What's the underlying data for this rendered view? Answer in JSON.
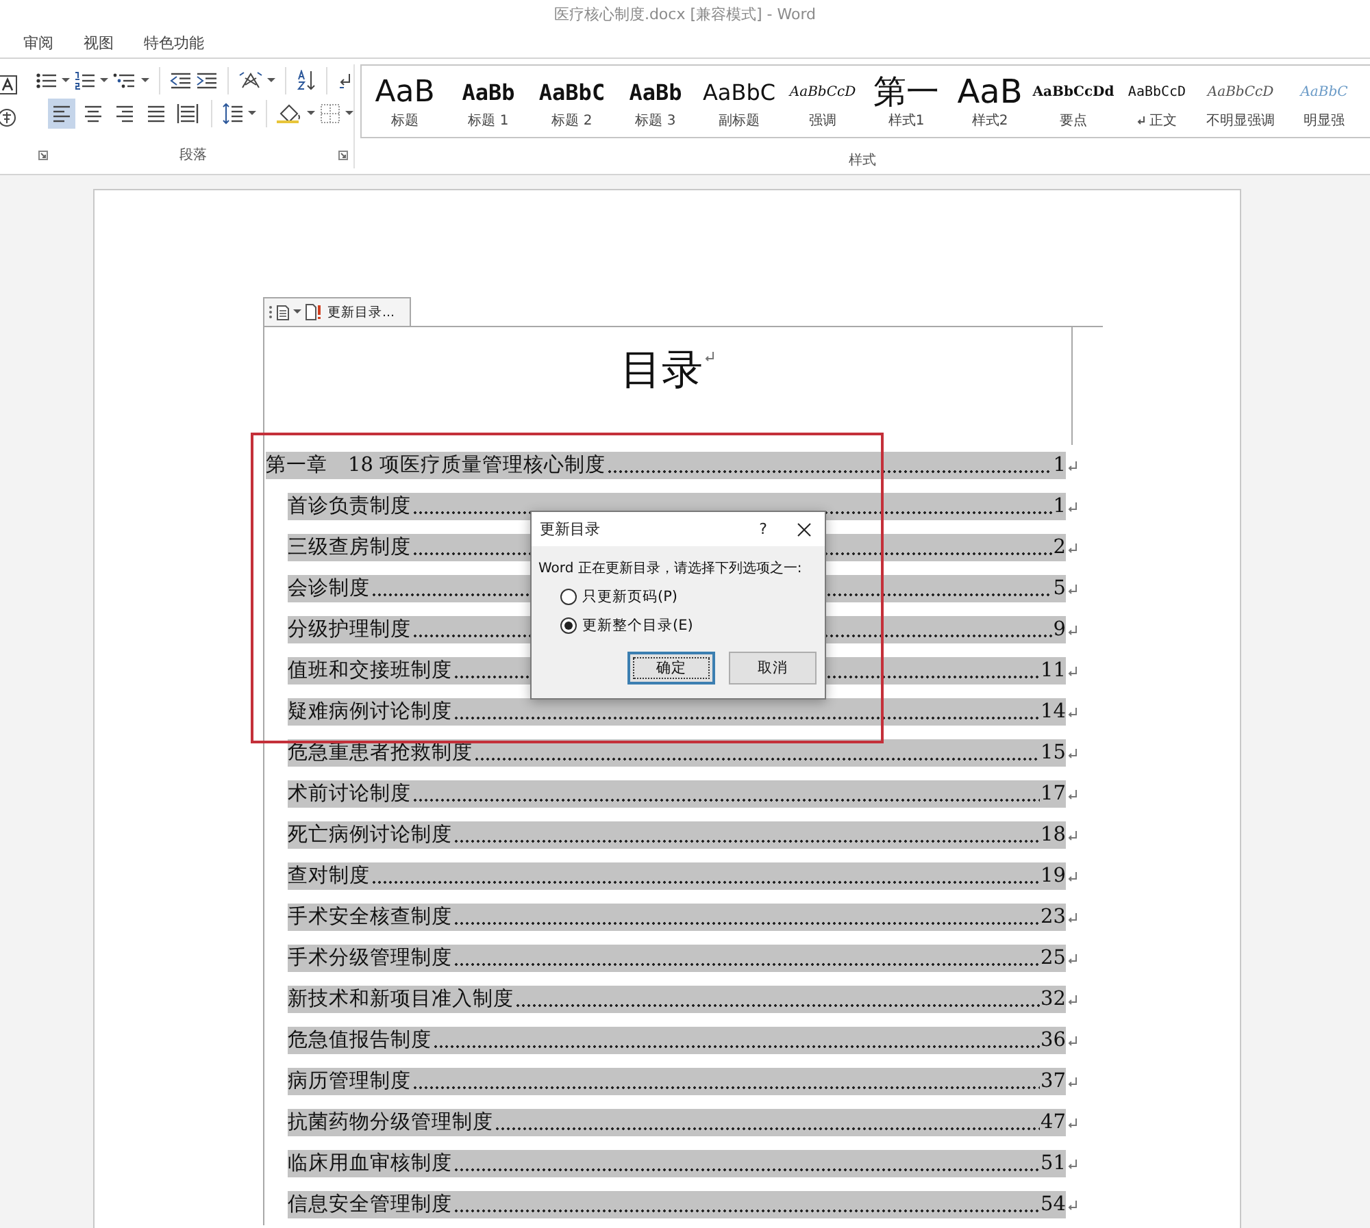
{
  "window": {
    "title": "医疗核心制度.docx [兼容模式] - Word"
  },
  "tabs": [
    {
      "label": "审阅",
      "selected": false
    },
    {
      "label": "视图",
      "selected": false
    },
    {
      "label": "特色功能",
      "selected": false
    }
  ],
  "paragraph": {
    "label": "段落",
    "align_buttons": [
      {
        "kind": "left",
        "selected": true
      },
      {
        "kind": "center",
        "selected": false
      },
      {
        "kind": "right",
        "selected": false
      },
      {
        "kind": "justify",
        "selected": false
      },
      {
        "kind": "distributed",
        "selected": false
      }
    ]
  },
  "styles": {
    "label": "样式",
    "items": [
      {
        "preview": "AaB",
        "label": "标题",
        "kind": "title"
      },
      {
        "preview": "AaBb",
        "label": "标题 1",
        "kind": "heading"
      },
      {
        "preview": "AaBbC",
        "label": "标题 2",
        "kind": "heading"
      },
      {
        "preview": "AaBb",
        "label": "标题 3",
        "kind": "heading"
      },
      {
        "preview": "AaBbC",
        "label": "副标题",
        "kind": "subtitle"
      },
      {
        "preview": "AaBbCcD",
        "label": "强调",
        "kind": "emphasis"
      },
      {
        "preview": "第一",
        "label": "样式1",
        "kind": "big"
      },
      {
        "preview": "AaB",
        "label": "样式2",
        "kind": "big"
      },
      {
        "preview": "AaBbCcDd",
        "label": "要点",
        "kind": "strong"
      },
      {
        "preview": "AaBbCcD",
        "label": "正文",
        "kind": "normal"
      },
      {
        "preview": "AaBbCcD",
        "label": "不明显强调",
        "kind": "subtle"
      },
      {
        "preview": "AaBbC",
        "label": "明显强",
        "kind": "intense"
      }
    ]
  },
  "toc_control": {
    "button": "更新目录..."
  },
  "document": {
    "heading": "目录",
    "toc": [
      {
        "title": "第一章　18 项医疗质量管理核心制度",
        "page": "1",
        "children": [
          {
            "title": "首诊负责制度",
            "page": "1"
          },
          {
            "title": "三级查房制度",
            "page": "2"
          },
          {
            "title": "会诊制度",
            "page": "5"
          },
          {
            "title": "分级护理制度",
            "page": "9"
          },
          {
            "title": "值班和交接班制度",
            "page": "11"
          },
          {
            "title": "疑难病例讨论制度",
            "page": "14"
          },
          {
            "title": "危急重患者抢救制度",
            "page": "15"
          },
          {
            "title": "术前讨论制度",
            "page": "17"
          },
          {
            "title": "死亡病例讨论制度",
            "page": "18"
          },
          {
            "title": "查对制度",
            "page": "19"
          },
          {
            "title": "手术安全核查制度",
            "page": "23"
          },
          {
            "title": "手术分级管理制度",
            "page": "25"
          },
          {
            "title": "新技术和新项目准入制度",
            "page": "32"
          },
          {
            "title": "危急值报告制度",
            "page": "36"
          },
          {
            "title": "病历管理制度",
            "page": "37"
          },
          {
            "title": "抗菌药物分级管理制度",
            "page": "47"
          },
          {
            "title": "临床用血审核制度",
            "page": "51"
          },
          {
            "title": "信息安全管理制度",
            "page": "54"
          }
        ]
      }
    ]
  },
  "dialog": {
    "title": "更新目录",
    "help": "?",
    "message": "Word 正在更新目录，请选择下列选项之一:",
    "options": [
      {
        "label": "只更新页码(P)",
        "selected": false
      },
      {
        "label": "更新整个目录(E)",
        "selected": true
      }
    ],
    "buttons": [
      {
        "label": "确定",
        "kind": "default"
      },
      {
        "label": "取消",
        "kind": "normal"
      }
    ]
  }
}
